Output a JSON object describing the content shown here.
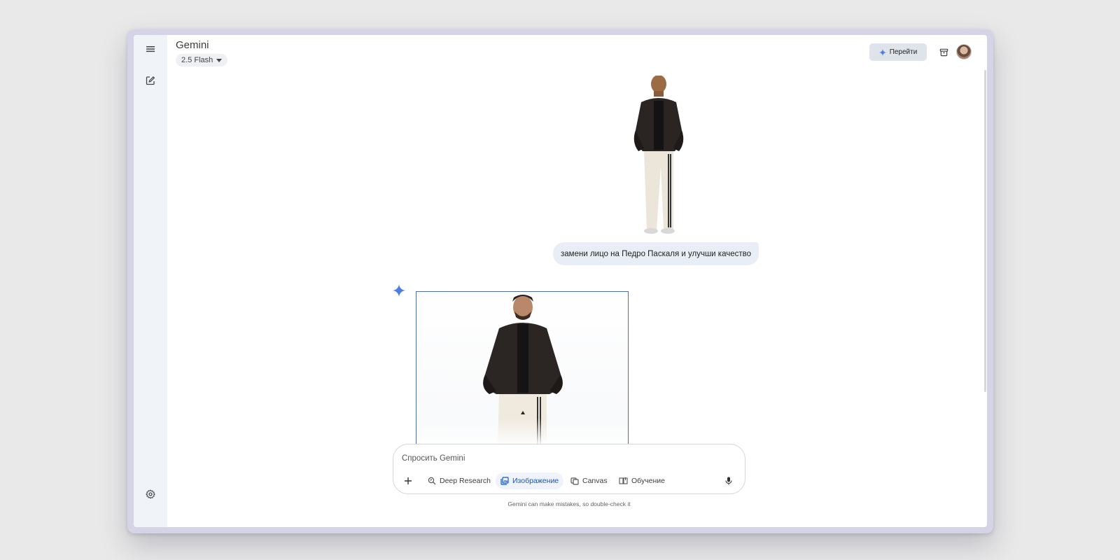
{
  "app": {
    "title": "Gemini",
    "model": "2.5 Flash"
  },
  "header": {
    "upgrade_button": "Перейти"
  },
  "conversation": {
    "user_message": "замени лицо на Педро Паскаля и улучши качество"
  },
  "composer": {
    "placeholder": "Спросить Gemini",
    "tools": [
      {
        "label": "Deep Research",
        "icon": "deep-research-icon",
        "active": false
      },
      {
        "label": "Изображение",
        "icon": "image-icon",
        "active": true
      },
      {
        "label": "Canvas",
        "icon": "canvas-icon",
        "active": false
      },
      {
        "label": "Обучение",
        "icon": "learning-icon",
        "active": false
      }
    ]
  },
  "footer": {
    "disclaimer": "Gemini can make mistakes, so double-check it"
  },
  "colors": {
    "accent": "#0b57d0",
    "sidebar_bg": "#f0f4f9",
    "user_bubble": "#e9eef6"
  }
}
